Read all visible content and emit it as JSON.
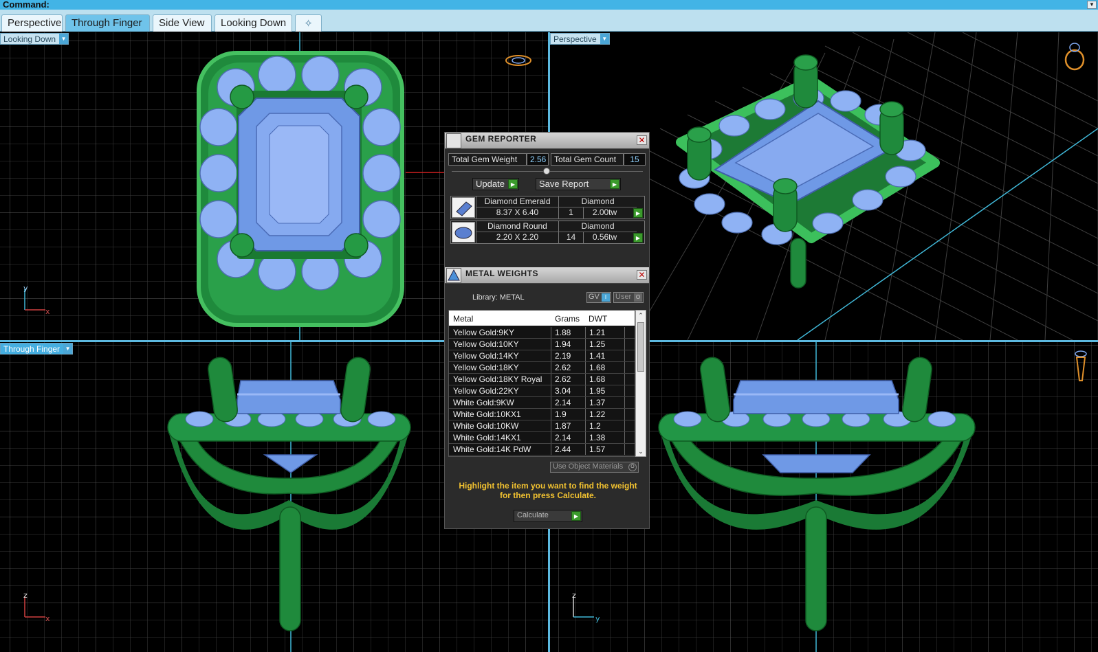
{
  "command_bar": {
    "label": "Command:",
    "dropdown_arrow": "chevron-down-icon"
  },
  "tabs": [
    {
      "label": "Perspective",
      "active": false
    },
    {
      "label": "Through Finger",
      "active": true
    },
    {
      "label": "Side View",
      "active": false
    },
    {
      "label": "Looking Down",
      "active": false
    },
    {
      "label": "✧",
      "active": false
    }
  ],
  "viewports": {
    "top_left": {
      "label": "Looking Down",
      "axis_a": "y",
      "axis_b": "x"
    },
    "top_right": {
      "label": "Perspective"
    },
    "bottom_left": {
      "label": "Through Finger",
      "axis_a": "z",
      "axis_b": "x"
    },
    "bottom_right": {
      "axis_a": "z",
      "axis_b": "y"
    }
  },
  "gem_reporter": {
    "title": "GEM REPORTER",
    "total_weight_label": "Total Gem Weight",
    "total_weight_value": "2.56",
    "total_count_label": "Total Gem Count",
    "total_count_value": "15",
    "update_label": "Update",
    "save_label": "Save Report",
    "gems": [
      {
        "name": "Diamond Emerald",
        "size": "8.37 X 6.40",
        "material": "Diamond",
        "count": "1",
        "weight": "2.00tw"
      },
      {
        "name": "Diamond Round",
        "size": "2.20 X 2.20",
        "material": "Diamond",
        "count": "14",
        "weight": "0.56tw"
      }
    ]
  },
  "metal_weights": {
    "title": "METAL WEIGHTS",
    "library_label": "Library: METAL",
    "gv_label": "GV",
    "user_label": "User",
    "columns": [
      "Metal",
      "Grams",
      "DWT"
    ],
    "rows": [
      {
        "metal": "Yellow Gold:9KY",
        "grams": "1.88",
        "dwt": "1.21"
      },
      {
        "metal": "Yellow Gold:10KY",
        "grams": "1.94",
        "dwt": "1.25"
      },
      {
        "metal": "Yellow Gold:14KY",
        "grams": "2.19",
        "dwt": "1.41"
      },
      {
        "metal": "Yellow Gold:18KY",
        "grams": "2.62",
        "dwt": "1.68"
      },
      {
        "metal": "Yellow Gold:18KY Royal",
        "grams": "2.62",
        "dwt": "1.68"
      },
      {
        "metal": "Yellow Gold:22KY",
        "grams": "3.04",
        "dwt": "1.95"
      },
      {
        "metal": "White Gold:9KW",
        "grams": "2.14",
        "dwt": "1.37"
      },
      {
        "metal": "White Gold:10KX1",
        "grams": "1.9",
        "dwt": "1.22"
      },
      {
        "metal": "White Gold:10KW",
        "grams": "1.87",
        "dwt": "1.2"
      },
      {
        "metal": "White Gold:14KX1",
        "grams": "2.14",
        "dwt": "1.38"
      },
      {
        "metal": "White Gold:14K PdW",
        "grams": "2.44",
        "dwt": "1.57"
      }
    ],
    "use_object_materials": "Use Object Materials",
    "hint": "Highlight the item you want to find the weight for then press Calculate.",
    "calculate_label": "Calculate"
  },
  "colors": {
    "metal": "#2a9a48",
    "gem": "#7fa8f0",
    "grid": "#3a3a3a",
    "axis": "#40b8d8",
    "accent": "#45aee0"
  }
}
